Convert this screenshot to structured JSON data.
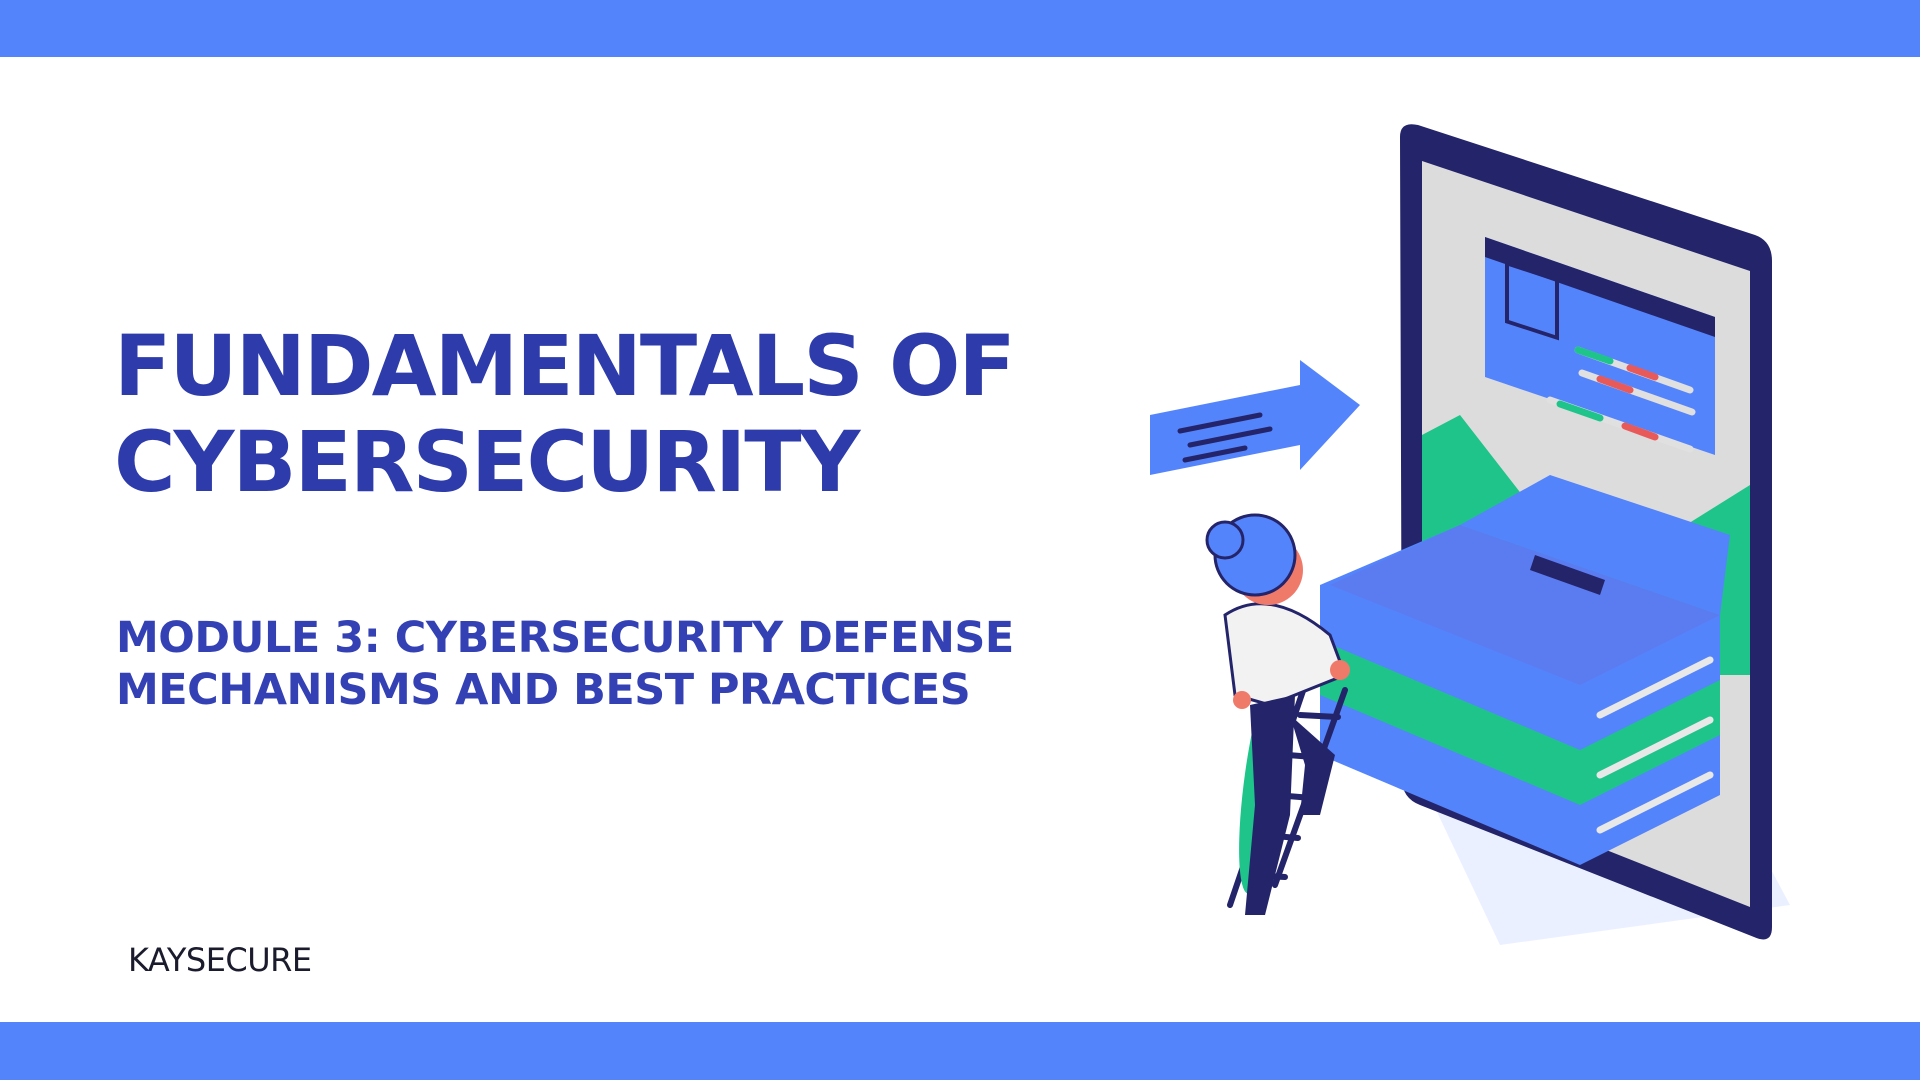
{
  "slide": {
    "title_line1": "FUNDAMENTALS OF",
    "title_line2": "CYBERSECURITY",
    "subtitle_line1": "MODULE 3: CYBERSECURITY DEFENSE",
    "subtitle_line2": "MECHANISMS AND BEST PRACTICES",
    "brand": "KAYSECURE"
  },
  "colors": {
    "accent_bar": "#5484fc",
    "title": "#2d3bab",
    "subtitle": "#3341b4",
    "brand_text": "#1b1b2e"
  },
  "illustration": {
    "icon": "person-climbing-books-into-phone-illustration"
  }
}
